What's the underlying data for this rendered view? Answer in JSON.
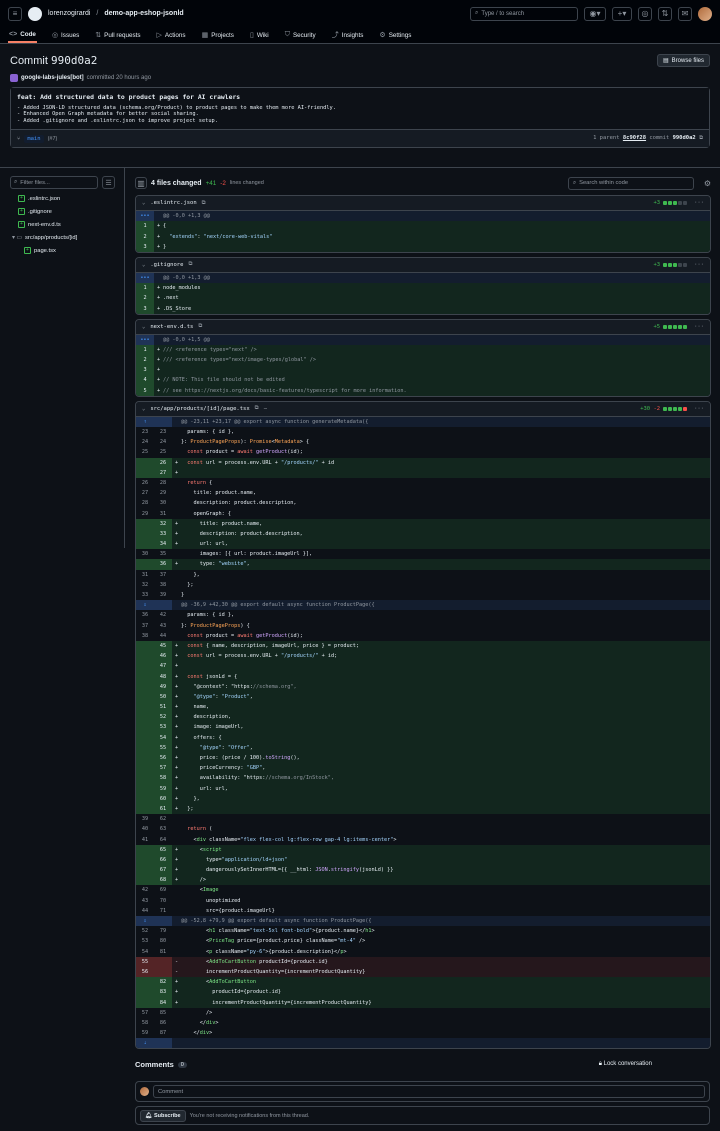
{
  "header": {
    "user": "lorenzogirardi",
    "repo": "demo-app-eshop-jsonld",
    "search_placeholder": "Type / to search",
    "search_key": "/"
  },
  "nav": {
    "tabs": [
      {
        "label": "Code",
        "icon": "<>",
        "active": true
      },
      {
        "label": "Issues",
        "icon": "◎"
      },
      {
        "label": "Pull requests",
        "icon": "⇅"
      },
      {
        "label": "Actions",
        "icon": "▷"
      },
      {
        "label": "Projects",
        "icon": "▦"
      },
      {
        "label": "Wiki",
        "icon": "▯"
      },
      {
        "label": "Security",
        "icon": "⛉"
      },
      {
        "label": "Insights",
        "icon": "⤴"
      },
      {
        "label": "Settings",
        "icon": "⚙"
      }
    ]
  },
  "commit": {
    "title_prefix": "Commit",
    "sha": "990d0a2",
    "browse_label": "Browse files",
    "author": "google-labs-jules[bot]",
    "committed": "committed 20 hours ago",
    "message_title": "feat: Add structured data to product pages for AI crawlers",
    "message_body": [
      "- Added JSON-LD structured data (schema.org/Product) to product pages to make them more AI-friendly.",
      "- Enhanced Open Graph metadata for better social sharing.",
      "- Added .gitignore and .eslintrc.json to improve project setup."
    ],
    "branch": "main",
    "branch_count": "(#7)",
    "parent_label": "1 parent",
    "parent_sha": "8c90f28",
    "commit_label": "commit",
    "commit_sha": "990d0a2"
  },
  "tree": {
    "filter_placeholder": "Filter files...",
    "items": [
      {
        "name": ".eslintrc.json",
        "type": "file"
      },
      {
        "name": ".gitignore",
        "type": "file"
      },
      {
        "name": "next-env.d.ts",
        "type": "file"
      },
      {
        "name": "src/app/products/[id]",
        "type": "folder"
      },
      {
        "name": "page.tsx",
        "type": "file"
      }
    ]
  },
  "summary": {
    "files": "4 files changed",
    "additions": "+41",
    "deletions": "-2",
    "lines_label": "lines changed",
    "search_placeholder": "Search within code"
  },
  "files": [
    {
      "name": ".eslintrc.json",
      "stat": "+3",
      "bars": [
        "g",
        "g",
        "g",
        "n",
        "n"
      ],
      "lines": [
        [
          "hunk",
          "",
          "",
          "",
          "@@ -0,0 +1,3 @@"
        ],
        [
          "add",
          "",
          "1",
          "+",
          "{"
        ],
        [
          "add",
          "",
          "2",
          "+",
          "  \"extends\": \"next/core-web-vitals\""
        ],
        [
          "add",
          "",
          "3",
          "+",
          "}"
        ]
      ]
    },
    {
      "name": ".gitignore",
      "stat": "+3",
      "bars": [
        "g",
        "g",
        "g",
        "n",
        "n"
      ],
      "lines": [
        [
          "hunk",
          "",
          "",
          "",
          "@@ -0,0 +1,3 @@"
        ],
        [
          "add",
          "",
          "1",
          "+",
          "node_modules"
        ],
        [
          "add",
          "",
          "2",
          "+",
          ".next"
        ],
        [
          "add",
          "",
          "3",
          "+",
          ".DS_Store"
        ]
      ]
    },
    {
      "name": "next-env.d.ts",
      "stat": "+5",
      "bars": [
        "g",
        "g",
        "g",
        "g",
        "g"
      ],
      "lines": [
        [
          "hunk",
          "",
          "",
          "",
          "@@ -0,0 +1,5 @@"
        ],
        [
          "add",
          "",
          "1",
          "+",
          "/// <reference types=\"next\" />"
        ],
        [
          "add",
          "",
          "2",
          "+",
          "/// <reference types=\"next/image-types/global\" />"
        ],
        [
          "add",
          "",
          "3",
          "+",
          ""
        ],
        [
          "add",
          "",
          "4",
          "+",
          "// NOTE: This file should not be edited"
        ],
        [
          "add",
          "",
          "5",
          "+",
          "// see https://nextjs.org/docs/basic-features/typescript for more information."
        ]
      ]
    },
    {
      "name": "src/app/products/[id]/page.tsx",
      "stat": "+30 -2",
      "statdel": true,
      "bars": [
        "g",
        "g",
        "g",
        "g",
        "r"
      ],
      "lines": [
        [
          "hunk",
          "",
          "",
          "",
          "@@ -23,11 +23,17 @@ export async function generateMetadata({"
        ],
        [
          "ctx",
          "23",
          "23",
          "",
          "  params: { id },"
        ],
        [
          "ctx",
          "24",
          "24",
          "",
          "}: ProductPageProps): Promise<Metadata> {"
        ],
        [
          "ctx",
          "25",
          "25",
          "",
          "  const product = await getProduct(id);"
        ],
        [
          "add",
          "",
          "26",
          "+",
          "  const url = process.env.URL + \"/products/\" + id"
        ],
        [
          "add",
          "",
          "27",
          "+",
          ""
        ],
        [
          "ctx",
          "26",
          "28",
          "",
          "  return {"
        ],
        [
          "ctx",
          "27",
          "29",
          "",
          "    title: product.name,"
        ],
        [
          "ctx",
          "28",
          "30",
          "",
          "    description: product.description,"
        ],
        [
          "ctx",
          "29",
          "31",
          "",
          "    openGraph: {"
        ],
        [
          "add",
          "",
          "32",
          "+",
          "      title: product.name,"
        ],
        [
          "add",
          "",
          "33",
          "+",
          "      description: product.description,"
        ],
        [
          "add",
          "",
          "34",
          "+",
          "      url: url,"
        ],
        [
          "ctx",
          "30",
          "35",
          "",
          "      images: [{ url: product.imageUrl }],"
        ],
        [
          "add",
          "",
          "36",
          "+",
          "      type: \"website\","
        ],
        [
          "ctx",
          "31",
          "37",
          "",
          "    },"
        ],
        [
          "ctx",
          "32",
          "38",
          "",
          "  };"
        ],
        [
          "ctx",
          "33",
          "39",
          "",
          "}"
        ],
        [
          "hunk",
          "",
          "",
          "",
          "@@ -36,9 +42,30 @@ export default async function ProductPage({"
        ],
        [
          "ctx",
          "36",
          "42",
          "",
          "  params: { id },"
        ],
        [
          "ctx",
          "37",
          "43",
          "",
          "}: ProductPageProps) {"
        ],
        [
          "ctx",
          "38",
          "44",
          "",
          "  const product = await getProduct(id);"
        ],
        [
          "add",
          "",
          "45",
          "+",
          "  const { name, description, imageUrl, price } = product;"
        ],
        [
          "add",
          "",
          "46",
          "+",
          "  const url = process.env.URL + \"/products/\" + id;"
        ],
        [
          "add",
          "",
          "47",
          "+",
          ""
        ],
        [
          "add",
          "",
          "48",
          "+",
          "  const jsonLd = {"
        ],
        [
          "add",
          "",
          "49",
          "+",
          "    \"@context\": \"https://schema.org\","
        ],
        [
          "add",
          "",
          "50",
          "+",
          "    \"@type\": \"Product\","
        ],
        [
          "add",
          "",
          "51",
          "+",
          "    name,"
        ],
        [
          "add",
          "",
          "52",
          "+",
          "    description,"
        ],
        [
          "add",
          "",
          "53",
          "+",
          "    image: imageUrl,"
        ],
        [
          "add",
          "",
          "54",
          "+",
          "    offers: {"
        ],
        [
          "add",
          "",
          "55",
          "+",
          "      \"@type\": \"Offer\","
        ],
        [
          "add",
          "",
          "56",
          "+",
          "      price: (price / 100).toString(),"
        ],
        [
          "add",
          "",
          "57",
          "+",
          "      priceCurrency: \"GBP\","
        ],
        [
          "add",
          "",
          "58",
          "+",
          "      availability: \"https://schema.org/InStock\","
        ],
        [
          "add",
          "",
          "59",
          "+",
          "      url: url,"
        ],
        [
          "add",
          "",
          "60",
          "+",
          "    },"
        ],
        [
          "add",
          "",
          "61",
          "+",
          "  };"
        ],
        [
          "ctx",
          "39",
          "62",
          "",
          ""
        ],
        [
          "ctx",
          "40",
          "63",
          "",
          "  return ("
        ],
        [
          "ctx",
          "41",
          "64",
          "",
          "    <div className=\"flex flex-col lg:flex-row gap-4 lg:items-center\">"
        ],
        [
          "add",
          "",
          "65",
          "+",
          "      <script"
        ],
        [
          "add",
          "",
          "66",
          "+",
          "        type=\"application/ld+json\""
        ],
        [
          "add",
          "",
          "67",
          "+",
          "        dangerouslySetInnerHTML={{ __html: JSON.stringify(jsonLd) }}"
        ],
        [
          "add",
          "",
          "68",
          "+",
          "      />"
        ],
        [
          "ctx",
          "42",
          "69",
          "",
          "      <Image"
        ],
        [
          "ctx",
          "43",
          "70",
          "",
          "        unoptimized"
        ],
        [
          "ctx",
          "44",
          "71",
          "",
          "        src={product.imageUrl}"
        ],
        [
          "hunk",
          "",
          "",
          "",
          "@@ -52,8 +79,9 @@ export default async function ProductPage({"
        ],
        [
          "ctx",
          "52",
          "79",
          "",
          "        <h1 className=\"text-5xl font-bold\">{product.name}</h1>"
        ],
        [
          "ctx",
          "53",
          "80",
          "",
          "        <PriceTag price={product.price} className=\"mt-4\" />"
        ],
        [
          "ctx",
          "54",
          "81",
          "",
          "        <p className=\"py-6\">{product.description}</p>"
        ],
        [
          "del",
          "55",
          "",
          "-",
          "        <AddToCartButton productId={product.id}"
        ],
        [
          "del",
          "56",
          "",
          "-",
          "        incrementProductQuantity={incrementProductQuantity}"
        ],
        [
          "add",
          "",
          "82",
          "+",
          "        <AddToCartButton"
        ],
        [
          "add",
          "",
          "83",
          "+",
          "          productId={product.id}"
        ],
        [
          "add",
          "",
          "84",
          "+",
          "          incrementProductQuantity={incrementProductQuantity}"
        ],
        [
          "ctx",
          "57",
          "85",
          "",
          "        />"
        ],
        [
          "ctx",
          "58",
          "86",
          "",
          "      </div>"
        ],
        [
          "ctx",
          "59",
          "87",
          "",
          "    </div>"
        ],
        [
          "hunk",
          "",
          "",
          "",
          ""
        ]
      ]
    }
  ],
  "comments": {
    "title": "Comments",
    "count": "0",
    "lock_label": "Lock conversation",
    "placeholder": "Comment",
    "subscribe_label": "Subscribe",
    "notify_text": "You're not receiving notifications from this thread."
  },
  "colors": {
    "added": "#3fb950",
    "deleted": "#f85149",
    "accent": "#f78166",
    "link": "#4493f8"
  }
}
